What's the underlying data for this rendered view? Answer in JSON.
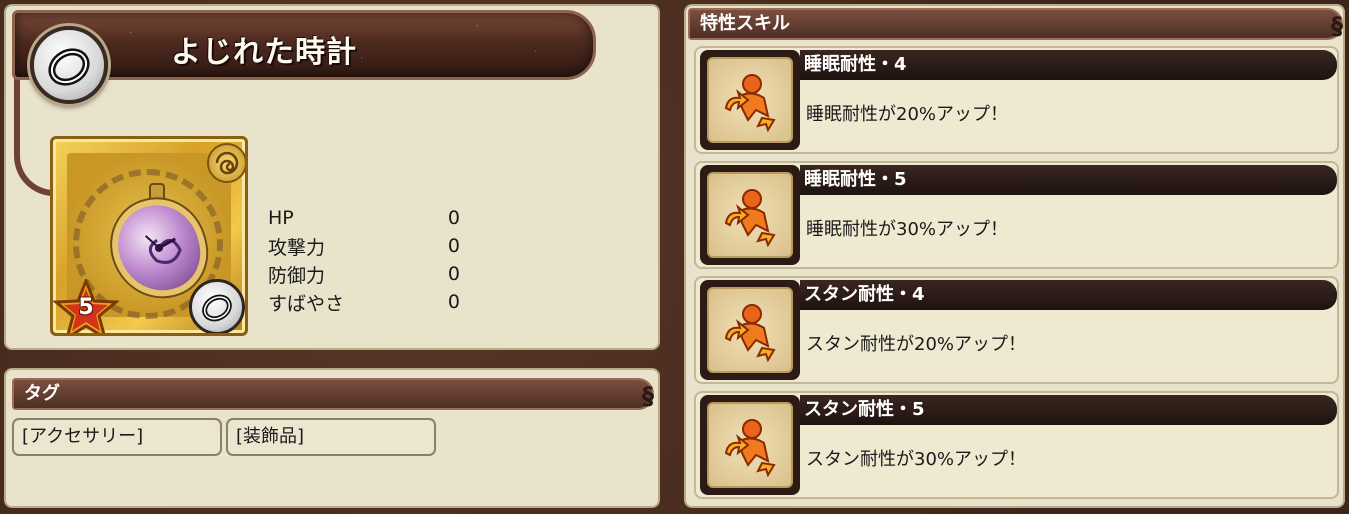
{
  "item": {
    "name": "よじれた時計",
    "rarity": "5",
    "type_icon": "ring-icon",
    "stats": [
      {
        "label": "HP",
        "value": "0"
      },
      {
        "label": "攻撃力",
        "value": "0"
      },
      {
        "label": "防御力",
        "value": "0"
      },
      {
        "label": "すばやさ",
        "value": "0"
      }
    ]
  },
  "tags": {
    "header": "タグ",
    "items": [
      "[アクセサリー]",
      "[装飾品]"
    ]
  },
  "skills": {
    "header": "特性スキル",
    "items": [
      {
        "name": "睡眠耐性・4",
        "desc": "睡眠耐性が20%アップ！",
        "icon": "resist-up-icon"
      },
      {
        "name": "睡眠耐性・5",
        "desc": "睡眠耐性が30%アップ！",
        "icon": "resist-up-icon"
      },
      {
        "name": "スタン耐性・4",
        "desc": "スタン耐性が20%アップ！",
        "icon": "resist-up-icon"
      },
      {
        "name": "スタン耐性・5",
        "desc": "スタン耐性が30%アップ！",
        "icon": "resist-up-icon"
      }
    ]
  },
  "colors": {
    "banner": "#4e2a1f",
    "panel": "#e9e3cc",
    "card_gold": "#d8a12a",
    "skill_icon_orange": "#e8641a"
  }
}
